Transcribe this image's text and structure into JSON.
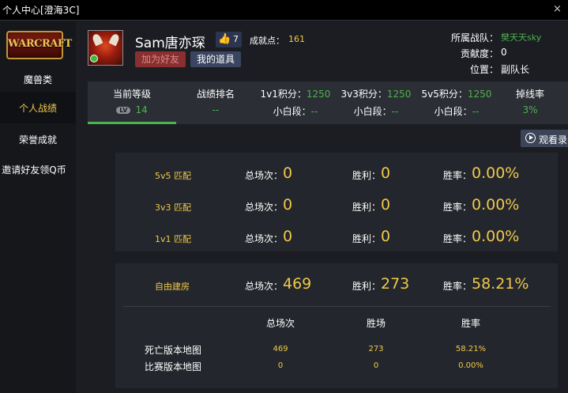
{
  "window": {
    "title": "个人中心[澄海3C]",
    "close_glyph": "×"
  },
  "sidebar": {
    "logo_text": "WARCRAFT",
    "items": [
      {
        "label": "魔兽类",
        "active": false
      },
      {
        "label": "个人战绩",
        "active": true
      },
      {
        "label": "荣誉成就",
        "active": false
      },
      {
        "label": "邀请好友领Q币",
        "active": false
      }
    ]
  },
  "profile": {
    "username": "Sam唐亦琛",
    "likes": "7",
    "achievement_label": "成就点：",
    "achievement_value": "161",
    "add_friend_label": "加为好友",
    "my_items_label": "我的道具",
    "team_label": "所属战队：",
    "team_value": "樊天天sky",
    "contribution_label": "贡献度：",
    "contribution_value": "0",
    "position_label": "位置：",
    "position_value": "副队长"
  },
  "stats": {
    "current_level_label": "当前等级",
    "level_badge": "LV",
    "level_value": "14",
    "rank_label": "战绩排名",
    "rank_value": "--",
    "score_1v1_label": "1v1积分：",
    "score_1v1_value": "1250",
    "score_3v3_label": "3v3积分：",
    "score_3v3_value": "1250",
    "score_5v5_label": "5v5积分：",
    "score_5v5_value": "1250",
    "tier_label": "小白段：",
    "tier_value": "--",
    "drop_rate_label": "掉线率",
    "drop_rate_value": "3%"
  },
  "watch_replay_label": "观看录",
  "ranked_matches": [
    {
      "name": "5v5 匹配",
      "total_label": "总场次：",
      "total": "0",
      "wins_label": "胜利：",
      "wins": "0",
      "rate_label": "胜率：",
      "rate": "0.00%"
    },
    {
      "name": "3v3 匹配",
      "total_label": "总场次：",
      "total": "0",
      "wins_label": "胜利：",
      "wins": "0",
      "rate_label": "胜率：",
      "rate": "0.00%"
    },
    {
      "name": "1v1 匹配",
      "total_label": "总场次：",
      "total": "0",
      "wins_label": "胜利：",
      "wins": "0",
      "rate_label": "胜率：",
      "rate": "0.00%"
    }
  ],
  "custom_room": {
    "name": "自由建房",
    "total_label": "总场次：",
    "total": "469",
    "wins_label": "胜利：",
    "wins": "273",
    "rate_label": "胜率：",
    "rate": "58.21%",
    "columns": [
      "总场次",
      "胜场",
      "胜率"
    ],
    "rows": [
      {
        "name": "死亡版本地图",
        "total": "469",
        "wins": "273",
        "rate": "58.21%"
      },
      {
        "name": "比赛版本地图",
        "total": "0",
        "wins": "0",
        "rate": "0.00%"
      }
    ]
  }
}
